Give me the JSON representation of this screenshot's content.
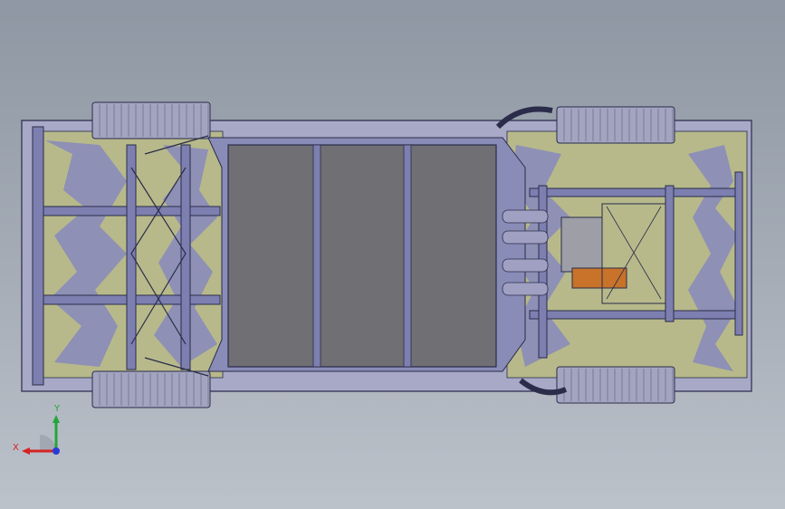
{
  "viewport": {
    "background_top": "#8e97a3",
    "background_bottom": "#bcc2ca"
  },
  "model": {
    "frame_color": "#7d7fb0",
    "frame_edge_color": "#2a2c4a",
    "floor_color": "#6f6f74",
    "panel_color_a": "#b7b98a",
    "panel_color_b": "#8e90b5",
    "wheel_color": "#a3a4bf",
    "engine_color": "#9d9ea6",
    "gearbox_color": "#c8722a"
  },
  "triad": {
    "x_label": "X",
    "y_label": "Y",
    "x_color": "#d42424",
    "y_color": "#22a63a",
    "z_color": "#2b3cd6"
  }
}
